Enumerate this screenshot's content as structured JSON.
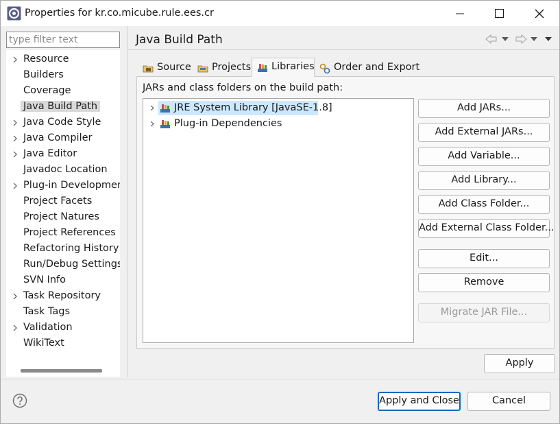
{
  "window": {
    "title": "Properties for kr.co.micube.rule.ees.cr",
    "icon": "eclipse-gear-icon",
    "controls": [
      "minimize-icon",
      "maximize-icon",
      "close-icon"
    ]
  },
  "filter": {
    "placeholder": "type filter text",
    "value": ""
  },
  "nav": {
    "items": [
      {
        "label": "Resource",
        "expandable": true
      },
      {
        "label": "Builders",
        "expandable": false
      },
      {
        "label": "Coverage",
        "expandable": false
      },
      {
        "label": "Java Build Path",
        "expandable": false,
        "selected": true
      },
      {
        "label": "Java Code Style",
        "expandable": true
      },
      {
        "label": "Java Compiler",
        "expandable": true
      },
      {
        "label": "Java Editor",
        "expandable": true
      },
      {
        "label": "Javadoc Location",
        "expandable": false
      },
      {
        "label": "Plug-in Developmen",
        "expandable": true
      },
      {
        "label": "Project Facets",
        "expandable": false
      },
      {
        "label": "Project Natures",
        "expandable": false
      },
      {
        "label": "Project References",
        "expandable": false
      },
      {
        "label": "Refactoring History",
        "expandable": false
      },
      {
        "label": "Run/Debug Settings",
        "expandable": false
      },
      {
        "label": "SVN Info",
        "expandable": false
      },
      {
        "label": "Task Repository",
        "expandable": true
      },
      {
        "label": "Task Tags",
        "expandable": false
      },
      {
        "label": "Validation",
        "expandable": true
      },
      {
        "label": "WikiText",
        "expandable": false
      }
    ]
  },
  "page": {
    "title": "Java Build Path"
  },
  "tabs": [
    {
      "label": "Source",
      "icon": "source-folder-icon"
    },
    {
      "label": "Projects",
      "icon": "projects-folder-icon"
    },
    {
      "label": "Libraries",
      "icon": "libraries-icon",
      "active": true
    },
    {
      "label": "Order and Export",
      "icon": "order-export-icon"
    }
  ],
  "libraries": {
    "section_label": "JARs and class folders on the build path:",
    "tree": [
      {
        "label": "JRE System Library [JavaSE-1.8]",
        "selected": true,
        "icon": "library-icon"
      },
      {
        "label": "Plug-in Dependencies",
        "selected": false,
        "icon": "library-icon"
      }
    ],
    "buttons": {
      "add_jars": "Add JARs...",
      "add_external_jars": "Add External JARs...",
      "add_variable": "Add Variable...",
      "add_library": "Add Library...",
      "add_class_folder": "Add Class Folder...",
      "add_external_class_folder": "Add External Class Folder...",
      "edit": "Edit...",
      "remove": "Remove",
      "migrate_jar": "Migrate JAR File..."
    }
  },
  "footer": {
    "apply": "Apply",
    "apply_and_close": "Apply and Close",
    "cancel": "Cancel"
  },
  "colors": {
    "accent": "#0067c0",
    "selection": "#cce8ff"
  }
}
